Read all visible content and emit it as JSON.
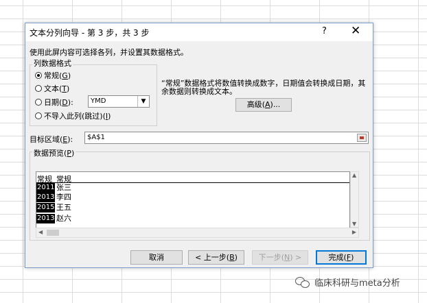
{
  "dialog": {
    "title": "文本分列向导 - 第 3 步，共 3 步",
    "help": "?",
    "close": "✕",
    "instruction": "使用此屏内容可选择各列，并设置其数据格式。"
  },
  "column_format": {
    "group_title": "列数据格式",
    "options": [
      {
        "text": "常规",
        "key": "G",
        "selected": true
      },
      {
        "text": "文本",
        "key": "T",
        "selected": false
      },
      {
        "text": "日期",
        "key": "D",
        "selected": false
      },
      {
        "text": "不导入此列(跳过)",
        "key": "I",
        "selected": false
      }
    ],
    "date_format": "YMD"
  },
  "description": "“常规”数据格式将数值转换成数字，日期值会转换成日期，其余数据则转换成文本。",
  "advanced_button": {
    "text": "高级",
    "key": "A",
    "suffix": "..."
  },
  "destination": {
    "label": "目标区域",
    "key": "E",
    "value": "$A$1"
  },
  "preview": {
    "title": "数据预览",
    "key": "P",
    "headers": [
      "常规",
      "常规"
    ],
    "rows": [
      [
        "2011",
        "张三"
      ],
      [
        "2013",
        "李四"
      ],
      [
        "2015",
        "王五"
      ],
      [
        "2013",
        "赵六"
      ]
    ]
  },
  "buttons": {
    "cancel": "取消",
    "back": {
      "prefix": "< 上一步",
      "key": "B"
    },
    "next": {
      "prefix": "下一步",
      "key": "N",
      "suffix": " >"
    },
    "finish": {
      "text": "完成",
      "key": "F"
    }
  },
  "watermark": "临床科研与meta分析"
}
